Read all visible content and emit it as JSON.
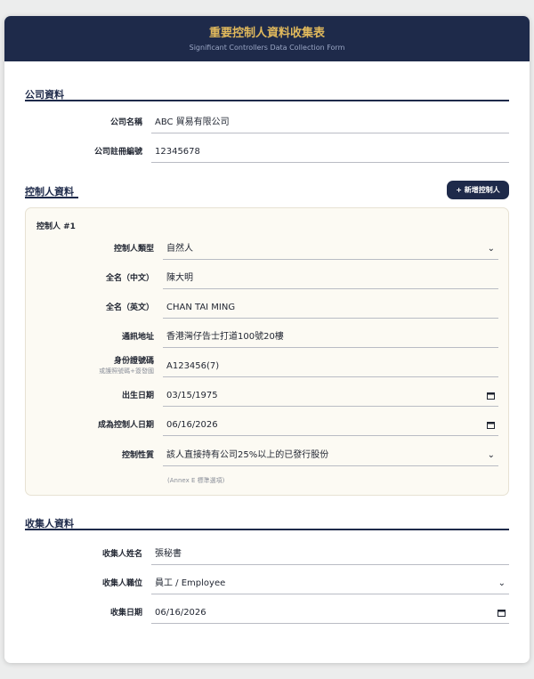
{
  "header": {
    "title": "重要控制人資料收集表",
    "subtitle": "Significant Controllers Data Collection Form"
  },
  "company": {
    "section_title": "公司資料",
    "name_label": "公司名稱",
    "name_value": "ABC 貿易有限公司",
    "reg_label": "公司註冊編號",
    "reg_value": "12345678"
  },
  "controllers": {
    "section_title": "控制人資料",
    "add_button": "+ 新增控制人",
    "items": [
      {
        "title": "控制人 #1",
        "type_label": "控制人類型",
        "type_value": "自然人",
        "name_zh_label": "全名（中文）",
        "name_zh_value": "陳大明",
        "name_en_label": "全名（英文）",
        "name_en_value": "CHAN TAI MING",
        "address_label": "通訊地址",
        "address_value": "香港灣仔告士打道100號20樓",
        "id_label": "身份證號碼",
        "id_sublabel": "或護照號碼+簽發國",
        "id_value": "A123456(7)",
        "dob_label": "出生日期",
        "dob_value": "03/15/1975",
        "since_label": "成為控制人日期",
        "since_value": "06/16/2026",
        "nature_label": "控制性質",
        "nature_value": "該人直接持有公司25%以上的已發行股份",
        "nature_note": "(Annex E 標準選項)"
      }
    ]
  },
  "collector": {
    "section_title": "收集人資料",
    "name_label": "收集人姓名",
    "name_value": "張秘書",
    "position_label": "收集人職位",
    "position_value": "員工 / Employee",
    "date_label": "收集日期",
    "date_value": "06/16/2026"
  },
  "icons": {
    "chevron": "⌄",
    "calendar": "calendar-icon"
  }
}
